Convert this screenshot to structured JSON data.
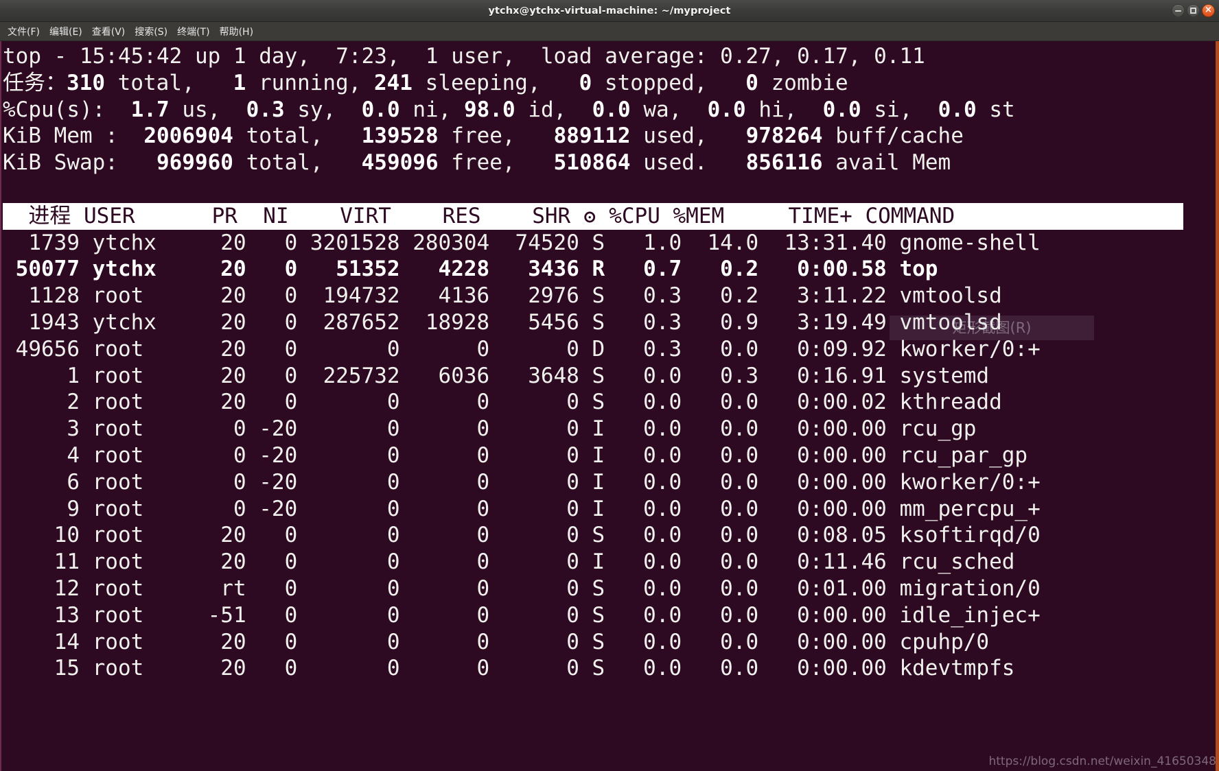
{
  "window": {
    "title": "ytchx@ytchx-virtual-machine: ~/myproject",
    "controls": {
      "minimize": "minimize-icon",
      "maximize": "maximize-icon",
      "close": "×"
    }
  },
  "menu": {
    "items": [
      {
        "label": "文件(F)"
      },
      {
        "label": "编辑(E)"
      },
      {
        "label": "查看(V)"
      },
      {
        "label": "搜索(S)"
      },
      {
        "label": "终端(T)"
      },
      {
        "label": "帮助(H)"
      }
    ]
  },
  "summary": {
    "uptime_line": {
      "program": "top",
      "time": "15:45:42",
      "up": "up 1 day,  7:23,",
      "users": "1 user,",
      "load_label": "load average:",
      "load_1": "0.27",
      "load_5": "0.17",
      "load_15": "0.11",
      "full": "top - 15:45:42 up 1 day,  7:23,  1 user,  load average: 0.27, 0.17, 0.11"
    },
    "tasks_line": {
      "label": "任务：",
      "total": "310",
      "total_label": "total,",
      "running": "1",
      "running_label": "running,",
      "sleeping": "241",
      "sleeping_label": "sleeping,",
      "stopped": "0",
      "stopped_label": "stopped,",
      "zombie": "0",
      "zombie_label": "zombie"
    },
    "cpu_line": {
      "label": "%Cpu(s):",
      "us": "1.7",
      "us_label": "us,",
      "sy": "0.3",
      "sy_label": "sy,",
      "ni": "0.0",
      "ni_label": "ni,",
      "id": "98.0",
      "id_label": "id,",
      "wa": "0.0",
      "wa_label": "wa,",
      "hi": "0.0",
      "hi_label": "hi,",
      "si": "0.0",
      "si_label": "si,",
      "st": "0.0",
      "st_label": "st"
    },
    "mem_line": {
      "label": "KiB Mem :",
      "total": "2006904",
      "total_label": "total,",
      "free": "139528",
      "free_label": "free,",
      "used": "889112",
      "used_label": "used,",
      "buff": "978264",
      "buff_label": "buff/cache"
    },
    "swap_line": {
      "label": "KiB Swap:",
      "total": "969960",
      "total_label": "total,",
      "free": "459096",
      "free_label": "free,",
      "used": "510864",
      "used_label": "used.",
      "avail": "856116",
      "avail_label": "avail Mem"
    }
  },
  "table": {
    "header": "  进程 USER      PR  NI    VIRT    RES    SHR ʘ %CPU %MEM     TIME+ COMMAND",
    "columns": [
      "进程",
      "USER",
      "PR",
      "NI",
      "VIRT",
      "RES",
      "SHR",
      "ʘ",
      "%CPU",
      "%MEM",
      "TIME+",
      "COMMAND"
    ],
    "rows": [
      {
        "bold": false,
        "text": "  1739 ytchx     20   0 3201528 280304  74520 S   1.0  14.0  13:31.40 gnome-shell",
        "pid": "1739",
        "user": "ytchx",
        "pr": "20",
        "ni": "0",
        "virt": "3201528",
        "res": "280304",
        "shr": "74520",
        "s": "S",
        "cpu": "1.0",
        "mem": "14.0",
        "time": "13:31.40",
        "command": "gnome-shell"
      },
      {
        "bold": true,
        "text": " 50077 ytchx     20   0   51352   4228   3436 R   0.7   0.2   0:00.58 top",
        "pid": "50077",
        "user": "ytchx",
        "pr": "20",
        "ni": "0",
        "virt": "51352",
        "res": "4228",
        "shr": "3436",
        "s": "R",
        "cpu": "0.7",
        "mem": "0.2",
        "time": "0:00.58",
        "command": "top"
      },
      {
        "bold": false,
        "text": "  1128 root      20   0  194732   4136   2976 S   0.3   0.2   3:11.22 vmtoolsd",
        "pid": "1128",
        "user": "root",
        "pr": "20",
        "ni": "0",
        "virt": "194732",
        "res": "4136",
        "shr": "2976",
        "s": "S",
        "cpu": "0.3",
        "mem": "0.2",
        "time": "3:11.22",
        "command": "vmtoolsd"
      },
      {
        "bold": false,
        "text": "  1943 ytchx     20   0  287652  18928   5456 S   0.3   0.9   3:19.49 vmtoolsd",
        "pid": "1943",
        "user": "ytchx",
        "pr": "20",
        "ni": "0",
        "virt": "287652",
        "res": "18928",
        "shr": "5456",
        "s": "S",
        "cpu": "0.3",
        "mem": "0.9",
        "time": "3:19.49",
        "command": "vmtoolsd"
      },
      {
        "bold": false,
        "text": " 49656 root      20   0       0      0      0 D   0.3   0.0   0:09.92 kworker/0:+",
        "pid": "49656",
        "user": "root",
        "pr": "20",
        "ni": "0",
        "virt": "0",
        "res": "0",
        "shr": "0",
        "s": "D",
        "cpu": "0.3",
        "mem": "0.0",
        "time": "0:09.92",
        "command": "kworker/0:+"
      },
      {
        "bold": false,
        "text": "     1 root      20   0  225732   6036   3648 S   0.0   0.3   0:16.91 systemd",
        "pid": "1",
        "user": "root",
        "pr": "20",
        "ni": "0",
        "virt": "225732",
        "res": "6036",
        "shr": "3648",
        "s": "S",
        "cpu": "0.0",
        "mem": "0.3",
        "time": "0:16.91",
        "command": "systemd"
      },
      {
        "bold": false,
        "text": "     2 root      20   0       0      0      0 S   0.0   0.0   0:00.02 kthreadd",
        "pid": "2",
        "user": "root",
        "pr": "20",
        "ni": "0",
        "virt": "0",
        "res": "0",
        "shr": "0",
        "s": "S",
        "cpu": "0.0",
        "mem": "0.0",
        "time": "0:00.02",
        "command": "kthreadd"
      },
      {
        "bold": false,
        "text": "     3 root       0 -20       0      0      0 I   0.0   0.0   0:00.00 rcu_gp",
        "pid": "3",
        "user": "root",
        "pr": "0",
        "ni": "-20",
        "virt": "0",
        "res": "0",
        "shr": "0",
        "s": "I",
        "cpu": "0.0",
        "mem": "0.0",
        "time": "0:00.00",
        "command": "rcu_gp"
      },
      {
        "bold": false,
        "text": "     4 root       0 -20       0      0      0 I   0.0   0.0   0:00.00 rcu_par_gp",
        "pid": "4",
        "user": "root",
        "pr": "0",
        "ni": "-20",
        "virt": "0",
        "res": "0",
        "shr": "0",
        "s": "I",
        "cpu": "0.0",
        "mem": "0.0",
        "time": "0:00.00",
        "command": "rcu_par_gp"
      },
      {
        "bold": false,
        "text": "     6 root       0 -20       0      0      0 I   0.0   0.0   0:00.00 kworker/0:+",
        "pid": "6",
        "user": "root",
        "pr": "0",
        "ni": "-20",
        "virt": "0",
        "res": "0",
        "shr": "0",
        "s": "I",
        "cpu": "0.0",
        "mem": "0.0",
        "time": "0:00.00",
        "command": "kworker/0:+"
      },
      {
        "bold": false,
        "text": "     9 root       0 -20       0      0      0 I   0.0   0.0   0:00.00 mm_percpu_+",
        "pid": "9",
        "user": "root",
        "pr": "0",
        "ni": "-20",
        "virt": "0",
        "res": "0",
        "shr": "0",
        "s": "I",
        "cpu": "0.0",
        "mem": "0.0",
        "time": "0:00.00",
        "command": "mm_percpu_+"
      },
      {
        "bold": false,
        "text": "    10 root      20   0       0      0      0 S   0.0   0.0   0:08.05 ksoftirqd/0",
        "pid": "10",
        "user": "root",
        "pr": "20",
        "ni": "0",
        "virt": "0",
        "res": "0",
        "shr": "0",
        "s": "S",
        "cpu": "0.0",
        "mem": "0.0",
        "time": "0:08.05",
        "command": "ksoftirqd/0"
      },
      {
        "bold": false,
        "text": "    11 root      20   0       0      0      0 I   0.0   0.0   0:11.46 rcu_sched",
        "pid": "11",
        "user": "root",
        "pr": "20",
        "ni": "0",
        "virt": "0",
        "res": "0",
        "shr": "0",
        "s": "I",
        "cpu": "0.0",
        "mem": "0.0",
        "time": "0:11.46",
        "command": "rcu_sched"
      },
      {
        "bold": false,
        "text": "    12 root      rt   0       0      0      0 S   0.0   0.0   0:01.00 migration/0",
        "pid": "12",
        "user": "root",
        "pr": "rt",
        "ni": "0",
        "virt": "0",
        "res": "0",
        "shr": "0",
        "s": "S",
        "cpu": "0.0",
        "mem": "0.0",
        "time": "0:01.00",
        "command": "migration/0"
      },
      {
        "bold": false,
        "text": "    13 root     -51   0       0      0      0 S   0.0   0.0   0:00.00 idle_injec+",
        "pid": "13",
        "user": "root",
        "pr": "-51",
        "ni": "0",
        "virt": "0",
        "res": "0",
        "shr": "0",
        "s": "S",
        "cpu": "0.0",
        "mem": "0.0",
        "time": "0:00.00",
        "command": "idle_injec+"
      },
      {
        "bold": false,
        "text": "    14 root      20   0       0      0      0 S   0.0   0.0   0:00.00 cpuhp/0",
        "pid": "14",
        "user": "root",
        "pr": "20",
        "ni": "0",
        "virt": "0",
        "res": "0",
        "shr": "0",
        "s": "S",
        "cpu": "0.0",
        "mem": "0.0",
        "time": "0:00.00",
        "command": "cpuhp/0"
      },
      {
        "bold": false,
        "text": "    15 root      20   0       0      0      0 S   0.0   0.0   0:00.00 kdevtmpfs",
        "pid": "15",
        "user": "root",
        "pr": "20",
        "ni": "0",
        "virt": "0",
        "res": "0",
        "shr": "0",
        "s": "S",
        "cpu": "0.0",
        "mem": "0.0",
        "time": "0:00.00",
        "command": "kdevtmpfs"
      }
    ]
  },
  "overlays": {
    "snip_tooltip": "矩形截图(R)",
    "watermark": "https://blog.csdn.net/weixin_41650348"
  },
  "colors": {
    "terminal_bg": "#2d0922",
    "terminal_fg": "#f0f0ec",
    "titlebar_bg": "#3b3b39",
    "header_bg": "#ffffff",
    "header_fg": "#2d0922",
    "close_btn": "#df4c18",
    "left_border": "#6e2b4e"
  }
}
